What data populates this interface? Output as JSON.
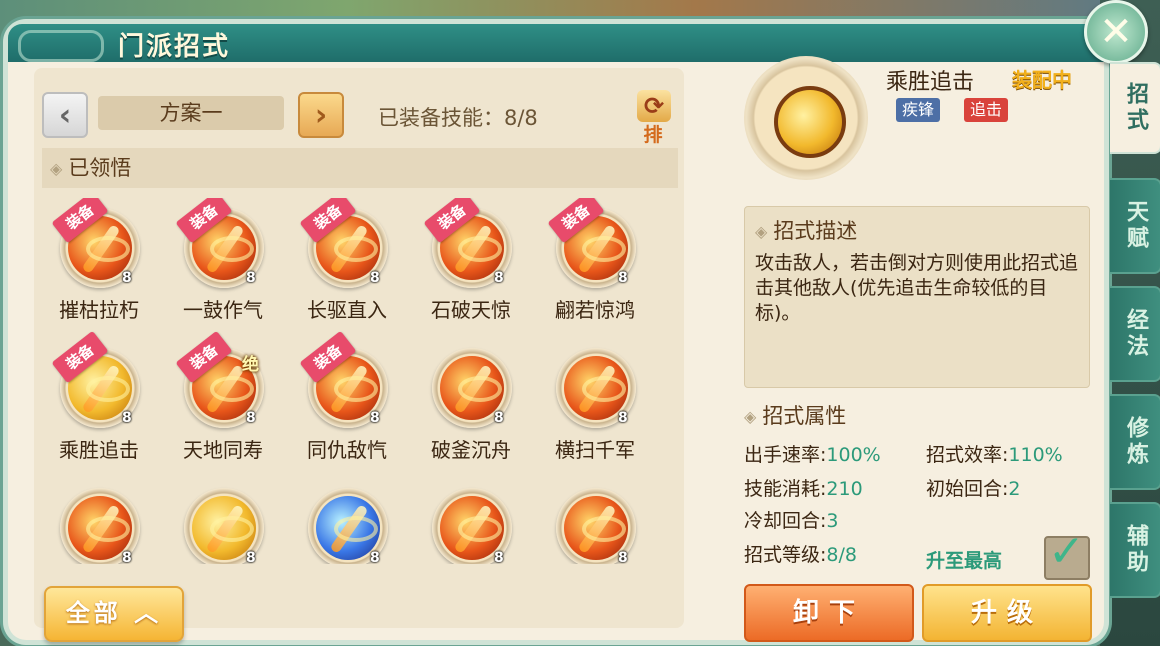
{
  "window": {
    "title": "门派招式",
    "close_symbol": "✕"
  },
  "toolbar": {
    "prev_symbol": "‹",
    "next_symbol": "›",
    "plan_name": "方案一",
    "equipped_count": "已装备技能：8/8",
    "sort_symbol": "⟳",
    "sort_label": "排序"
  },
  "section": {
    "diamond": "◈",
    "learned_header": "已领悟"
  },
  "skills": [
    {
      "name": "摧枯拉朽",
      "level": "8",
      "badge": "装备",
      "style": "fire"
    },
    {
      "name": "一鼓作气",
      "level": "8",
      "badge": "装备",
      "style": "fire"
    },
    {
      "name": "长驱直入",
      "level": "8",
      "badge": "装备",
      "style": "fire"
    },
    {
      "name": "石破天惊",
      "level": "8",
      "badge": "装备",
      "style": "fire"
    },
    {
      "name": "翩若惊鸿",
      "level": "8",
      "badge": "装备",
      "style": "fire"
    },
    {
      "name": "乘胜追击",
      "level": "8",
      "badge": "装备",
      "style": "gold"
    },
    {
      "name": "天地同寿",
      "level": "8",
      "badge": "装备",
      "ult": "绝",
      "style": "fire"
    },
    {
      "name": "同仇敌忾",
      "level": "8",
      "badge": "装备",
      "style": "fire"
    },
    {
      "name": "破釜沉舟",
      "level": "8",
      "style": "fire"
    },
    {
      "name": "横扫千军",
      "level": "8",
      "style": "fire"
    },
    {
      "name": "",
      "level": "8",
      "style": "fire"
    },
    {
      "name": "",
      "level": "8",
      "style": "gold"
    },
    {
      "name": "",
      "level": "8",
      "style": "blue"
    },
    {
      "name": "",
      "level": "8",
      "style": "fire"
    },
    {
      "name": "",
      "level": "8",
      "style": "fire"
    }
  ],
  "filter_button": "全部 ︿",
  "detail": {
    "name": "乘胜追击",
    "status": "装配中",
    "tags": [
      "疾锋",
      "追击"
    ],
    "desc_header": "招式描述",
    "description": "攻击敌人，若击倒对方则使用此招式追击其他敌人(优先追击生命较低的目标)。",
    "attr_header": "招式属性",
    "attributes": [
      {
        "label": "出手速率:",
        "value": "100%"
      },
      {
        "label": "招式效率:",
        "value": "110%"
      },
      {
        "label": "技能消耗:",
        "value": "210"
      },
      {
        "label": "初始回合:",
        "value": "2"
      },
      {
        "label": "冷却回合:",
        "value": "3"
      },
      {
        "label": "招式等级:",
        "value": "8/8"
      }
    ],
    "max_label": "升至最高",
    "check_symbol": "✓",
    "unload_button": "卸下",
    "upgrade_button": "升级"
  },
  "side_tabs": [
    "招式",
    "天赋",
    "经法",
    "修炼",
    "辅助"
  ],
  "colors": {
    "accent_teal": "#2f8f86",
    "value_green": "#2c9a7a",
    "equip_badge": "#e84b6b",
    "button_orange": "#ec6b26",
    "button_gold": "#f3b433"
  }
}
